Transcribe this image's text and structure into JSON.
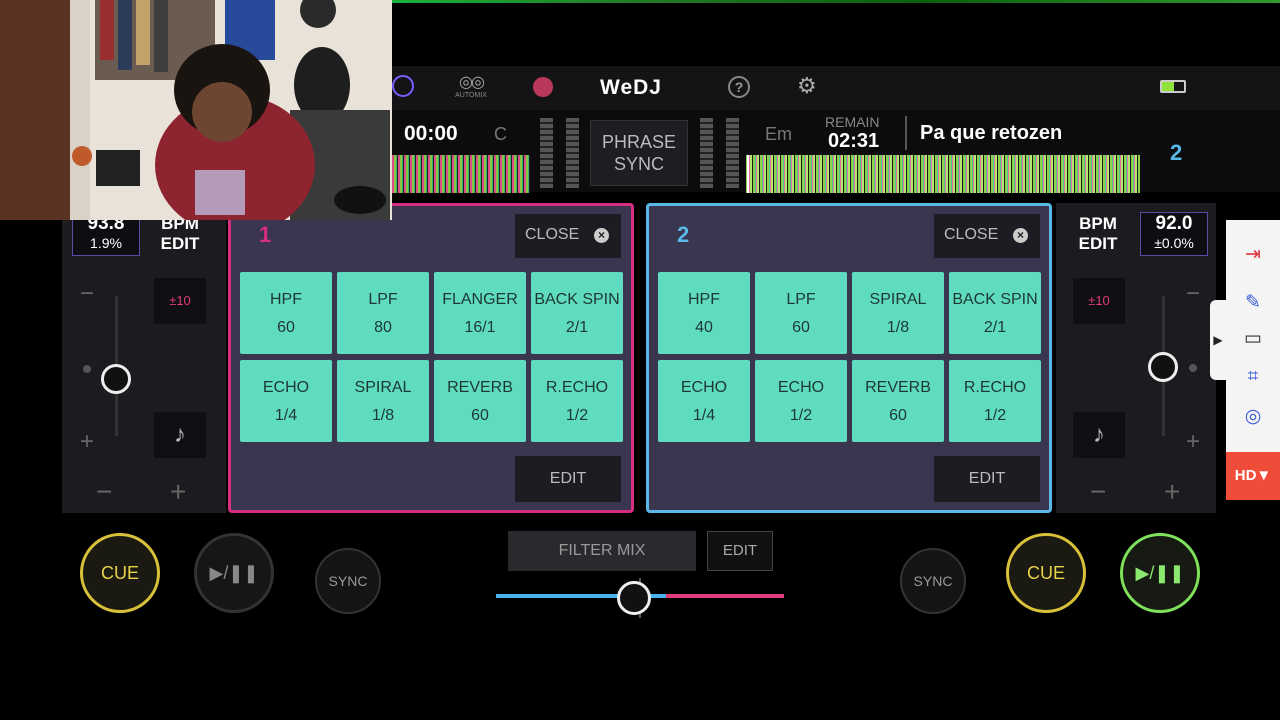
{
  "header": {
    "logo": "WeDJ",
    "automix_label": "AUTOMIX",
    "help_glyph": "?",
    "settings_glyph": "⚙"
  },
  "deck_left": {
    "time": "00:00",
    "key": "C",
    "bpm": "93.8",
    "pitch": "1.9%",
    "bpm_edit": "BPM\nEDIT",
    "range": "±10",
    "cue": "CUE",
    "play": "▶/❚❚",
    "sync": "SYNC"
  },
  "deck_right": {
    "number": "2",
    "key": "Em",
    "remain_label": "REMAIN",
    "remain": "02:31",
    "track_title": "Pa que retozen",
    "bpm": "92.0",
    "pitch": "±0.0%",
    "bpm_edit": "BPM\nEDIT",
    "range": "±10",
    "cue": "CUE",
    "play": "▶/❚❚",
    "sync": "SYNC"
  },
  "phrase_sync": "PHRASE\nSYNC",
  "fx1": {
    "number": "1",
    "close": "CLOSE",
    "edit": "EDIT",
    "pads": [
      {
        "name": "HPF",
        "value": "60"
      },
      {
        "name": "LPF",
        "value": "80"
      },
      {
        "name": "FLANGER",
        "value": "16/1"
      },
      {
        "name": "BACK SPIN",
        "value": "2/1"
      },
      {
        "name": "ECHO",
        "value": "1/4"
      },
      {
        "name": "SPIRAL",
        "value": "1/8"
      },
      {
        "name": "REVERB",
        "value": "60"
      },
      {
        "name": "R.ECHO",
        "value": "1/2"
      }
    ]
  },
  "fx2": {
    "number": "2",
    "close": "CLOSE",
    "edit": "EDIT",
    "pads": [
      {
        "name": "HPF",
        "value": "40"
      },
      {
        "name": "LPF",
        "value": "60"
      },
      {
        "name": "SPIRAL",
        "value": "1/8"
      },
      {
        "name": "BACK SPIN",
        "value": "2/1"
      },
      {
        "name": "ECHO",
        "value": "1/4"
      },
      {
        "name": "ECHO",
        "value": "1/2"
      },
      {
        "name": "REVERB",
        "value": "60"
      },
      {
        "name": "R.ECHO",
        "value": "1/2"
      }
    ]
  },
  "mixer": {
    "filter_mix": "FILTER MIX",
    "edit": "EDIT",
    "crossfader_position": 0.48
  },
  "screen_recorder": {
    "hd": "HD▼"
  },
  "colors": {
    "deck1": "#d92d7f",
    "deck2": "#5ab8e8",
    "pad": "#5fdcc0",
    "cue": "#d9c23a",
    "play_active": "#7fe05a"
  }
}
